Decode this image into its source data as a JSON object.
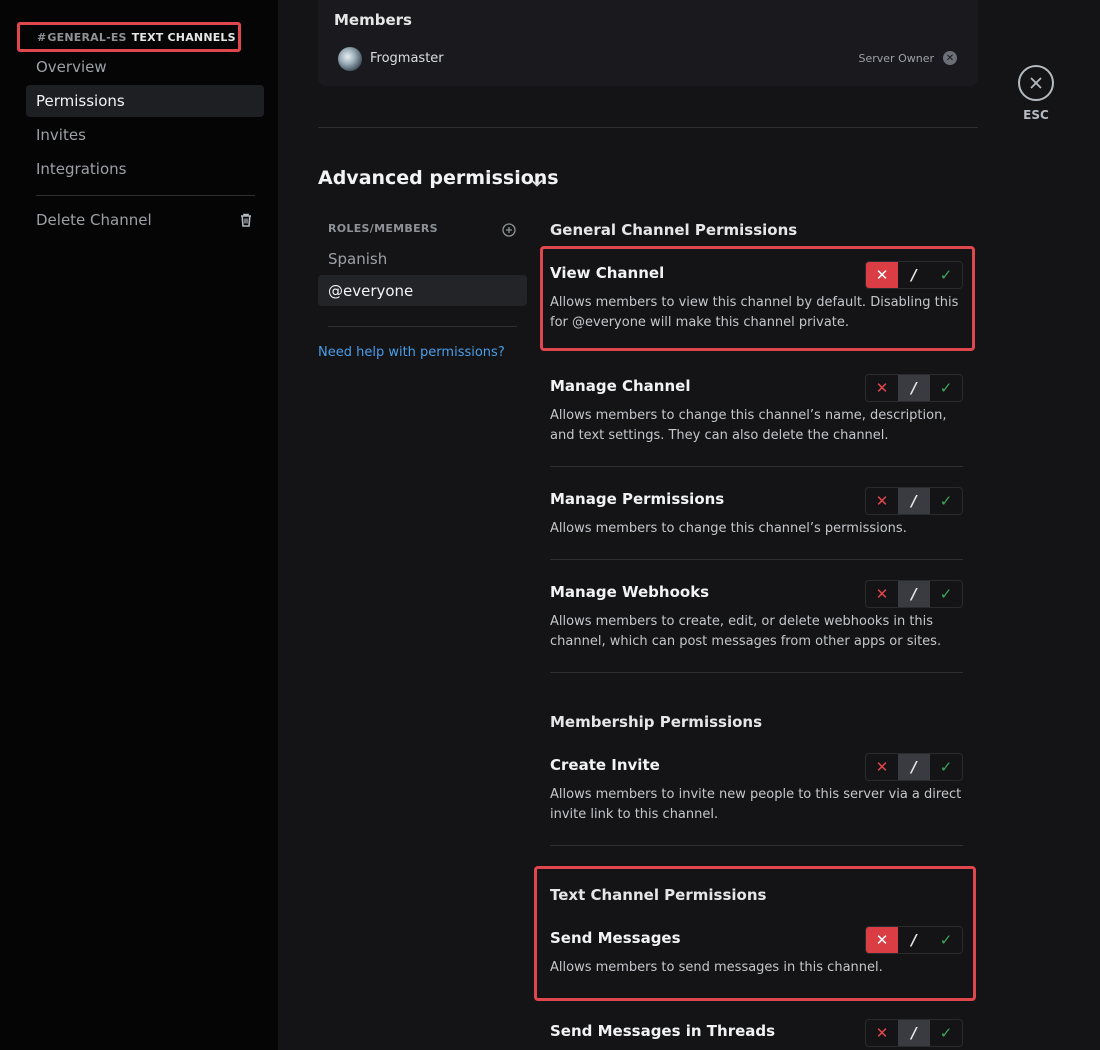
{
  "sidebar": {
    "channel_hash": "#",
    "channel_name": "GENERAL-ES",
    "category": "TEXT CHANNELS",
    "items": [
      {
        "label": "Overview"
      },
      {
        "label": "Permissions"
      },
      {
        "label": "Invites"
      },
      {
        "label": "Integrations"
      }
    ],
    "delete_label": "Delete Channel"
  },
  "members": {
    "title": "Members",
    "member_name": "Frogmaster",
    "role_label": "Server Owner"
  },
  "esc_label": "ESC",
  "advanced": {
    "title": "Advanced permissions",
    "roles_header": "ROLES/MEMBERS",
    "roles": [
      "Spanish",
      "@everyone"
    ],
    "help_link": "Need help with permissions?"
  },
  "sections": {
    "general": "General Channel Permissions",
    "membership": "Membership Permissions",
    "text": "Text Channel Permissions"
  },
  "permissions": {
    "view_channel": {
      "title": "View Channel",
      "desc": "Allows members to view this channel by default. Disabling this for @everyone will make this channel private.",
      "state": "deny"
    },
    "manage_channel": {
      "title": "Manage Channel",
      "desc": "Allows members to change this channel’s name, description, and text settings. They can also delete the channel.",
      "state": "neutral"
    },
    "manage_permissions": {
      "title": "Manage Permissions",
      "desc": "Allows members to change this channel’s permissions.",
      "state": "neutral"
    },
    "manage_webhooks": {
      "title": "Manage Webhooks",
      "desc": "Allows members to create, edit, or delete webhooks in this channel, which can post messages from other apps or sites.",
      "state": "neutral"
    },
    "create_invite": {
      "title": "Create Invite",
      "desc": "Allows members to invite new people to this server via a direct invite link to this channel.",
      "state": "neutral"
    },
    "send_messages": {
      "title": "Send Messages",
      "desc": "Allows members to send messages in this channel.",
      "state": "deny"
    },
    "send_messages_threads": {
      "title": "Send Messages in Threads",
      "state": "neutral"
    }
  },
  "toggle_glyphs": {
    "deny": "✕",
    "neutral": "/",
    "allow": "✓"
  },
  "colors": {
    "deny": "#da3e44",
    "allow": "#3ba55c",
    "highlight": "#e0464d",
    "link": "#4a9de8"
  }
}
